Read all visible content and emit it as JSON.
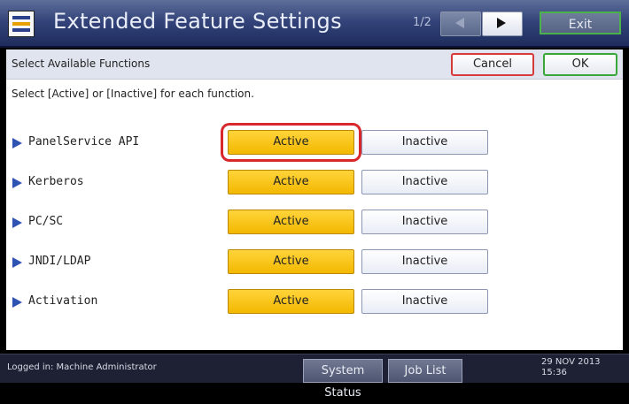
{
  "titlebar": {
    "title": "Extended Feature Settings",
    "page_indicator": "1/2",
    "exit_label": "Exit"
  },
  "header": {
    "section_label": "Select Available Functions",
    "cancel_label": "Cancel",
    "ok_label": "OK"
  },
  "instruction": "Select [Active] or [Inactive] for each function.",
  "rows": [
    {
      "label": "PanelService API",
      "active_label": "Active",
      "inactive_label": "Inactive",
      "state": "active",
      "highlighted": true
    },
    {
      "label": "Kerberos",
      "active_label": "Active",
      "inactive_label": "Inactive",
      "state": "active",
      "highlighted": false
    },
    {
      "label": "PC/SC",
      "active_label": "Active",
      "inactive_label": "Inactive",
      "state": "active",
      "highlighted": false
    },
    {
      "label": "JNDI/LDAP",
      "active_label": "Active",
      "inactive_label": "Inactive",
      "state": "active",
      "highlighted": false
    },
    {
      "label": "Activation",
      "active_label": "Active",
      "inactive_label": "Inactive",
      "state": "active",
      "highlighted": false
    }
  ],
  "footer": {
    "logged_in": "Logged in: Machine Administrator",
    "system_status_label": "System Status",
    "job_list_label": "Job List",
    "date": "29 NOV  2013",
    "time": "15:36"
  },
  "icons": {
    "app": "extended-feature-icon",
    "prev": "triangle-left-icon",
    "next": "triangle-right-icon",
    "bullet": "triangle-right-bullet-icon"
  },
  "colors": {
    "active_fill": "#ffd43a",
    "highlight_outline": "#d8282e",
    "cancel_border": "#d63a3a",
    "ok_border": "#38a638",
    "bullet": "#2f53b3"
  }
}
